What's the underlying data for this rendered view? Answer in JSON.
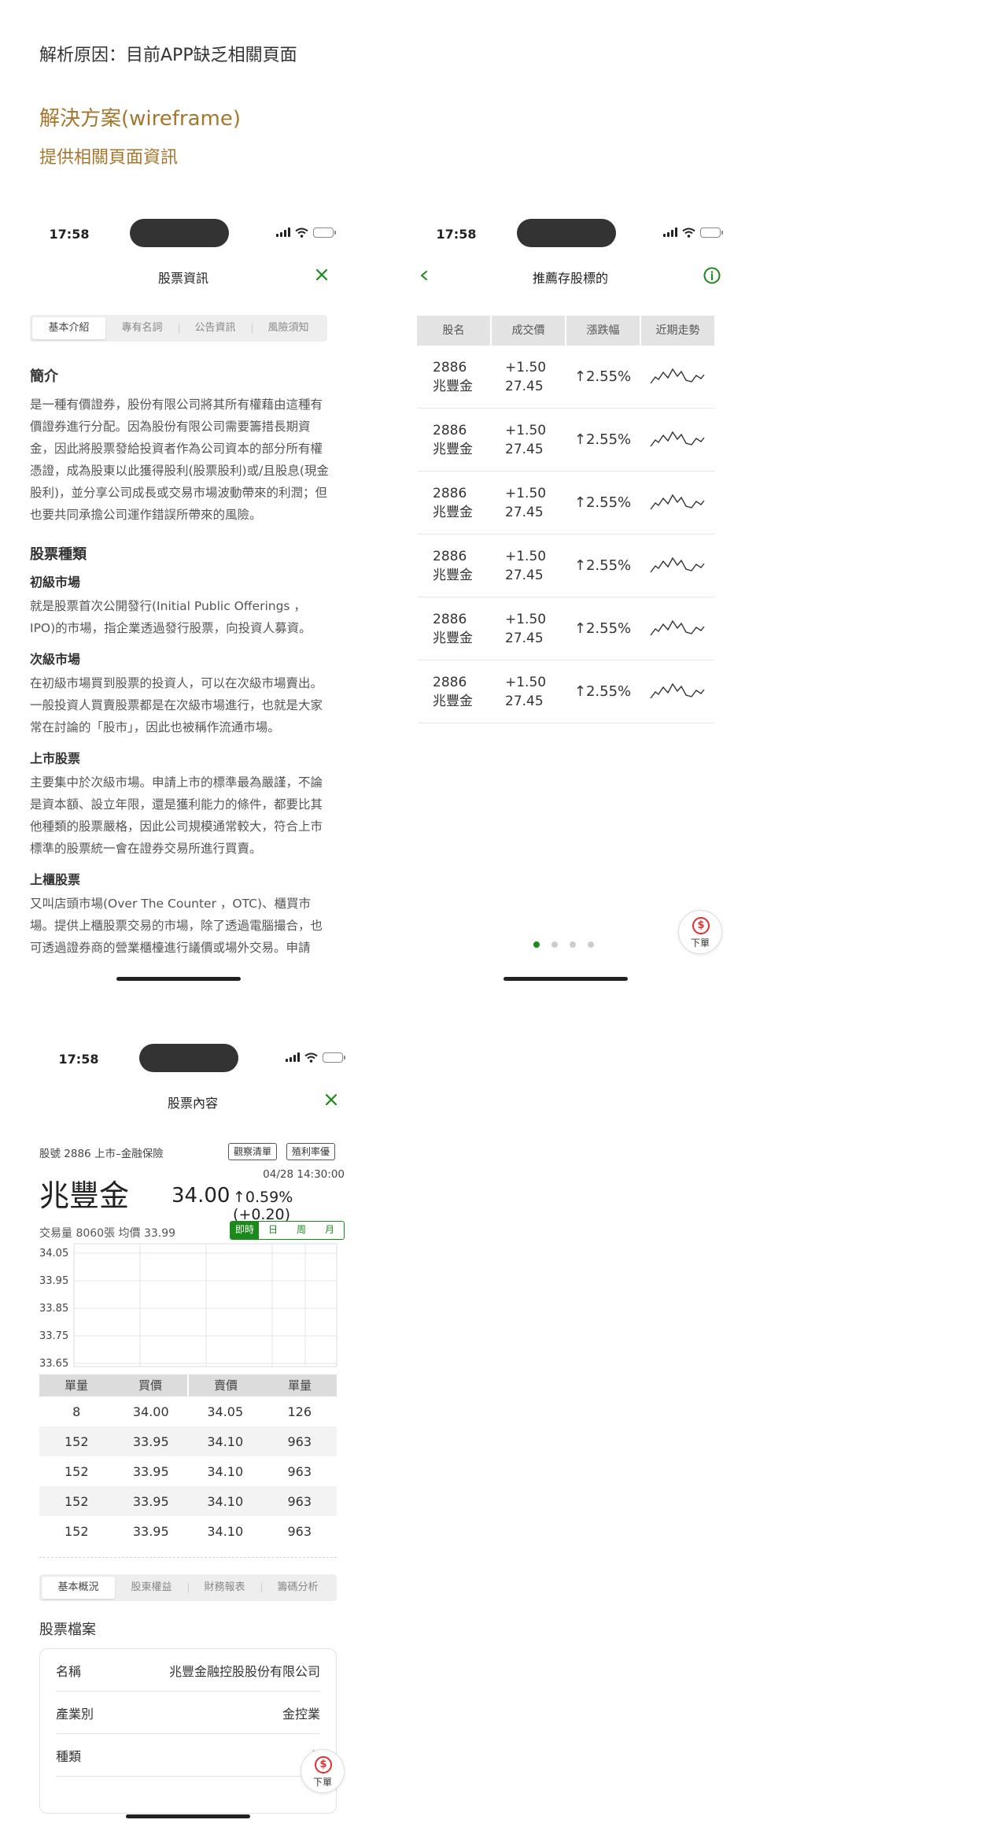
{
  "headings": {
    "analysis": "解析原因：目前APP缺乏相關頁面",
    "solution": "解決方案(wireframe)",
    "sub": "提供相關頁面資訊"
  },
  "status_time": "17:58",
  "colors": {
    "accent_green": "#1a8a1a",
    "heading_gold": "#A5772D",
    "up_red": "#e03030"
  },
  "phone1": {
    "title": "股票資訊",
    "tabs": [
      "基本介紹",
      "專有名詞",
      "公告資訊",
      "風險須知"
    ],
    "sections": {
      "intro_title": "簡介",
      "intro_text": "是一種有價證券，股份有限公司將其所有權藉由這種有價證券進行分配。因為股份有限公司需要籌措長期資金，因此將股票發給投資者作為公司資本的部分所有權憑證，成為股東以此獲得股利(股票股利)或/且股息(現金股利)，並分享公司成長或交易市場波動帶來的利潤；但也要共同承擔公司運作錯誤所帶來的風險。",
      "types_title": "股票種類",
      "primary_title": "初級市場",
      "primary_text": "就是股票首次公開發行(Initial Public Offerings ，IPO)的市場，指企業透過發行股票，向投資人募資。",
      "secondary_title": "次級市場",
      "secondary_text": "在初級市場買到股票的投資人，可以在次級市場賣出。一般投資人買賣股票都是在次級市場進行，也就是大家常在討論的「股市」，因此也被稱作流通市場。",
      "listed_title": "上市股票",
      "listed_text": "主要集中於次級市場。申請上市的標準最為嚴謹，不論是資本額、設立年限，還是獲利能力的條件，都要比其他種類的股票嚴格，因此公司規模通常較大，符合上市標準的股票統一會在證券交易所進行買賣。",
      "otc_title": "上櫃股票",
      "otc_text": "又叫店頭市場(Over The Counter ，OTC)、櫃買市場。提供上櫃股票交易的市場，除了透過電腦撮合，也可透過證券商的營業櫃檯進行議價或場外交易。申請"
    }
  },
  "phone2": {
    "title": "推薦存股標的",
    "columns": [
      "股名",
      "成交價",
      "漲跌幅",
      "近期走勢"
    ],
    "rows": [
      {
        "code": "2886",
        "name": "兆豐金",
        "change": "+1.50",
        "price": "27.45",
        "pct": "↑2.55%"
      },
      {
        "code": "2886",
        "name": "兆豐金",
        "change": "+1.50",
        "price": "27.45",
        "pct": "↑2.55%"
      },
      {
        "code": "2886",
        "name": "兆豐金",
        "change": "+1.50",
        "price": "27.45",
        "pct": "↑2.55%"
      },
      {
        "code": "2886",
        "name": "兆豐金",
        "change": "+1.50",
        "price": "27.45",
        "pct": "↑2.55%"
      },
      {
        "code": "2886",
        "name": "兆豐金",
        "change": "+1.50",
        "price": "27.45",
        "pct": "↑2.55%"
      },
      {
        "code": "2886",
        "name": "兆豐金",
        "change": "+1.50",
        "price": "27.45",
        "pct": "↑2.55%"
      }
    ],
    "fab_label": "下單",
    "pager": {
      "count": 4,
      "active": 0
    }
  },
  "phone3": {
    "title": "股票內容",
    "meta": "股號 2886  上市–金融保險",
    "tag_watch": "觀察清單",
    "tag_yield": "殖利率優",
    "datetime": "04/28 14:30:00",
    "stock_name": "兆豐金",
    "price": "34.00",
    "change": "↑0.59%(+0.20)",
    "volume": "交易量 8060張  均價 33.99",
    "periods": [
      "即時",
      "日",
      "周",
      "月"
    ],
    "chart_data": {
      "type": "line",
      "y_ticks": [
        "34.05",
        "33.95",
        "33.85",
        "33.75",
        "33.65"
      ],
      "ylim": [
        33.65,
        34.05
      ],
      "series": []
    },
    "orderbook": {
      "headers": [
        "單量",
        "買價",
        "賣價",
        "單量"
      ],
      "rows": [
        [
          "8",
          "34.00",
          "34.05",
          "126"
        ],
        [
          "152",
          "33.95",
          "34.10",
          "963"
        ],
        [
          "152",
          "33.95",
          "34.10",
          "963"
        ],
        [
          "152",
          "33.95",
          "34.10",
          "963"
        ],
        [
          "152",
          "33.95",
          "34.10",
          "963"
        ]
      ]
    },
    "tabs": [
      "基本概況",
      "股東權益",
      "財務報表",
      "籌碼分析"
    ],
    "profile_title": "股票檔案",
    "profile": [
      {
        "label": "名稱",
        "value": "兆豐金融控股股份有限公司"
      },
      {
        "label": "產業別",
        "value": "金控業"
      },
      {
        "label": "種類",
        "value": "上"
      }
    ],
    "fab_label": "下單"
  }
}
